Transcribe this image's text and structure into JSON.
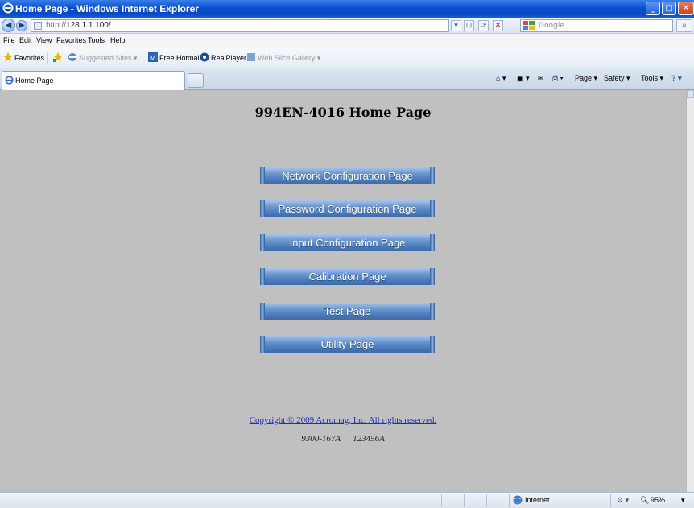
{
  "window": {
    "title": "Home Page - Windows Internet Explorer"
  },
  "addressbar": {
    "protocol": "http://",
    "host": "128.1.1.100/",
    "search_placeholder": "Google"
  },
  "menu": [
    "File",
    "Edit",
    "View",
    "Favorites",
    "Tools",
    "Help"
  ],
  "favorites_bar": {
    "favorites_label": "Favorites",
    "items": [
      "Suggested Sites ▾",
      "Free Hotmail",
      "RealPlayer",
      "Web Slice Gallery ▾"
    ]
  },
  "tab": {
    "label": "Home Page"
  },
  "command_bar": {
    "page": "Page ▾",
    "safety": "Safety ▾",
    "tools": "Tools ▾"
  },
  "page": {
    "title": "994EN-4016 Home Page",
    "buttons": [
      "Network Configuration Page",
      "Password Configuration Page",
      "Input Configuration Page",
      "Calibration Page",
      "Test Page",
      "Utility Page"
    ],
    "copyright": "Copyright © 2009 Acromag, Inc. All rights reserved.",
    "version_left": "9300-167A",
    "version_right": "123456A"
  },
  "status": {
    "zone": "Internet",
    "zoom": "95%"
  }
}
